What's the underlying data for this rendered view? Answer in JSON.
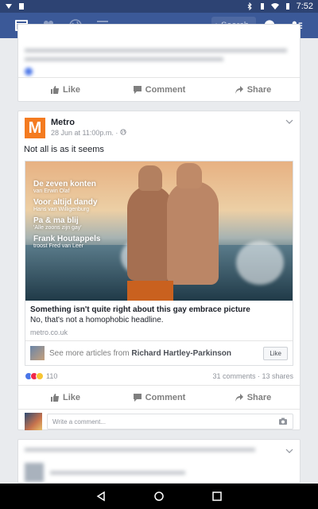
{
  "status_bar": {
    "time": "7:52"
  },
  "top_bar": {
    "search_placeholder": "Search",
    "nav_icons": [
      "news-feed-icon",
      "friends-icon",
      "globe-icon",
      "menu-icon"
    ]
  },
  "prev_post": {
    "actions": {
      "like": "Like",
      "comment": "Comment",
      "share": "Share"
    }
  },
  "post": {
    "page_name": "Metro",
    "logo_letter": "M",
    "timestamp": "28 Jun at 11:00p.m. · ",
    "caption": "Not all is as it seems",
    "image_headlines": [
      {
        "title": "De zeven konten",
        "subtitle": "van Erwin Olaf"
      },
      {
        "title": "Voor altijd dandy",
        "subtitle": "Hans van Willigenburg"
      },
      {
        "title": "Pa & ma blij",
        "subtitle": "'Alle zoons zijn gay'"
      },
      {
        "title": "Frank Houtappels",
        "subtitle": "troost Fred van Leer"
      }
    ],
    "link": {
      "title": "Something isn't quite right about this gay embrace picture",
      "description": "No, that's not a homophobic headline.",
      "domain": "metro.co.uk"
    },
    "see_more": {
      "prefix": "See more articles from ",
      "author": "Richard Hartley-Parkinson",
      "like_label": "Like"
    },
    "reactions": {
      "count": "110",
      "stats": "31 comments · 13 shares",
      "icons": [
        "like-reaction-icon",
        "love-reaction-icon",
        "haha-reaction-icon"
      ]
    },
    "actions": {
      "like": "Like",
      "comment": "Comment",
      "share": "Share"
    },
    "comment_placeholder": "Write a comment..."
  },
  "colors": {
    "brand_blue": "#3b5998",
    "status_bar": "#2d4373",
    "metro_orange": "#f47b20",
    "background": "#e9ebee"
  }
}
